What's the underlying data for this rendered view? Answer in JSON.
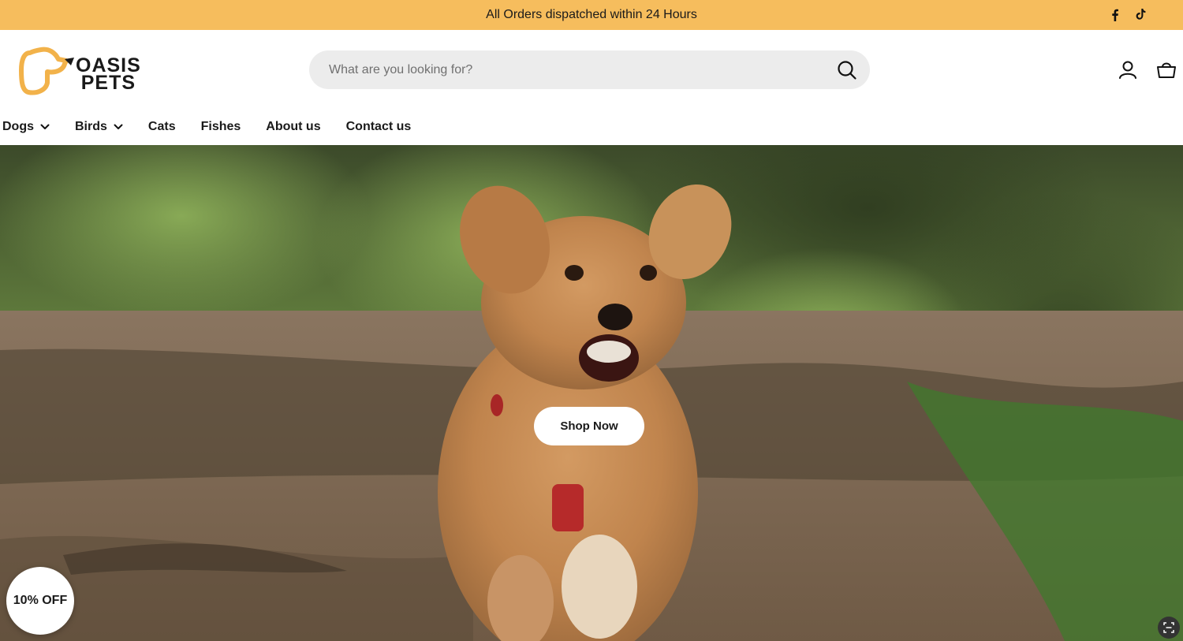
{
  "announcement": {
    "text": "All Orders dispatched within 24 Hours",
    "background": "#f6bd5d",
    "social": [
      "facebook-icon",
      "tiktok-icon"
    ]
  },
  "header": {
    "logo": {
      "line1": "OASIS",
      "line2": "PETS",
      "brand_color": "#f2b24a"
    },
    "search": {
      "placeholder": "What are you looking for?",
      "value": ""
    },
    "icons": [
      "search-icon",
      "account-icon",
      "cart-icon"
    ]
  },
  "nav": {
    "items": [
      {
        "label": "Dogs",
        "dropdown": true
      },
      {
        "label": "Birds",
        "dropdown": true
      },
      {
        "label": "Cats",
        "dropdown": false
      },
      {
        "label": "Fishes",
        "dropdown": false
      },
      {
        "label": "About us",
        "dropdown": false
      },
      {
        "label": "Contact us",
        "dropdown": false
      }
    ]
  },
  "hero": {
    "cta_label": "Shop Now"
  },
  "popups": {
    "discount_label": "10% OFF",
    "scan_icon": "scan-icon"
  }
}
